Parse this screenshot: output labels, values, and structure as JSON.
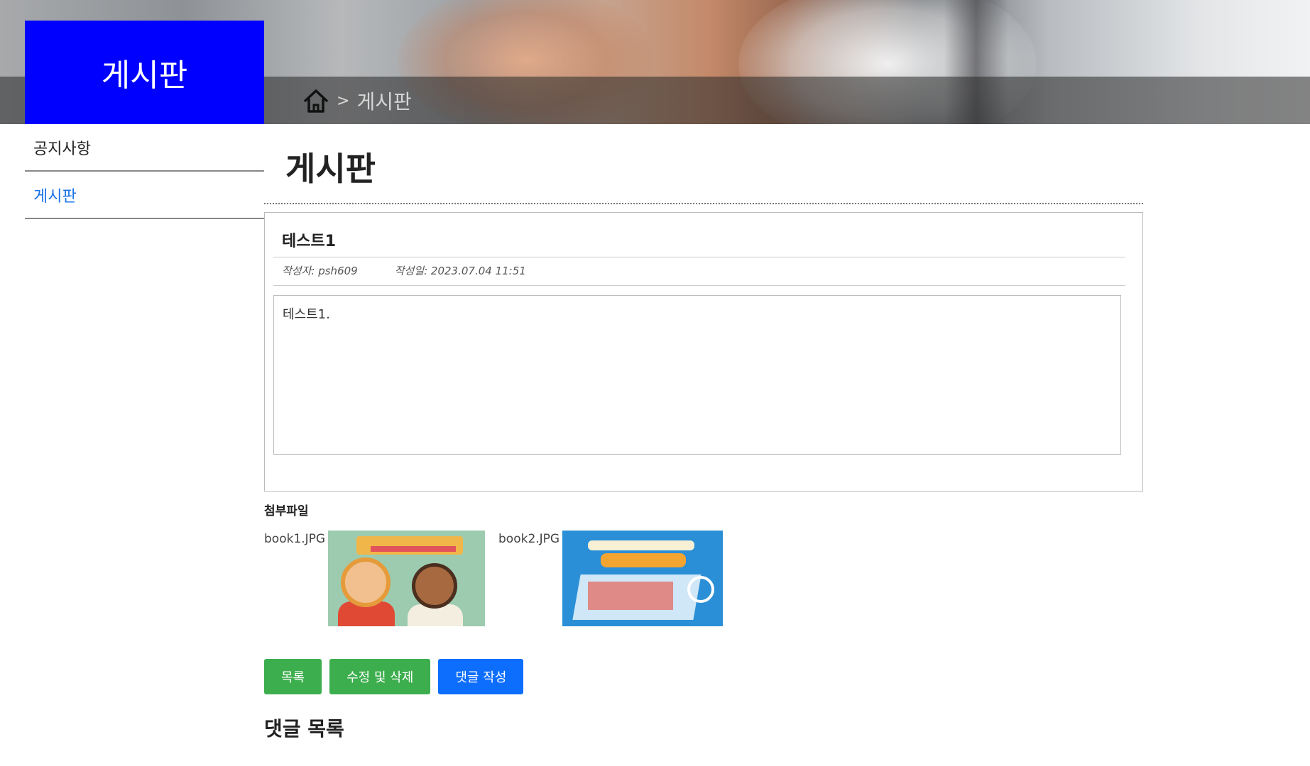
{
  "sidebar": {
    "title": "게시판",
    "items": [
      {
        "label": "공지사항",
        "active": false
      },
      {
        "label": "게시판",
        "active": true
      }
    ]
  },
  "breadcrumb": {
    "separator": ">",
    "current": "게시판",
    "home_icon": "home-icon"
  },
  "page": {
    "title": "게시판"
  },
  "post": {
    "title": "테스트1",
    "author": "작성자: psh609",
    "date": "작성일: 2023.07.04 11:51",
    "content": "테스트1."
  },
  "attachments": {
    "label": "첨부파일",
    "files": [
      {
        "name": "book1.JPG"
      },
      {
        "name": "book2.JPG"
      }
    ]
  },
  "buttons": {
    "list": "목록",
    "edit_delete": "수정 및 삭제",
    "write_comment": "댓글 작성"
  },
  "comments": {
    "heading": "댓글 목록"
  },
  "colors": {
    "sidebar_title_bg": "#0000ff",
    "active_link": "#1a73e8",
    "button_green": "#3cae4d",
    "button_blue": "#0d6efd"
  }
}
